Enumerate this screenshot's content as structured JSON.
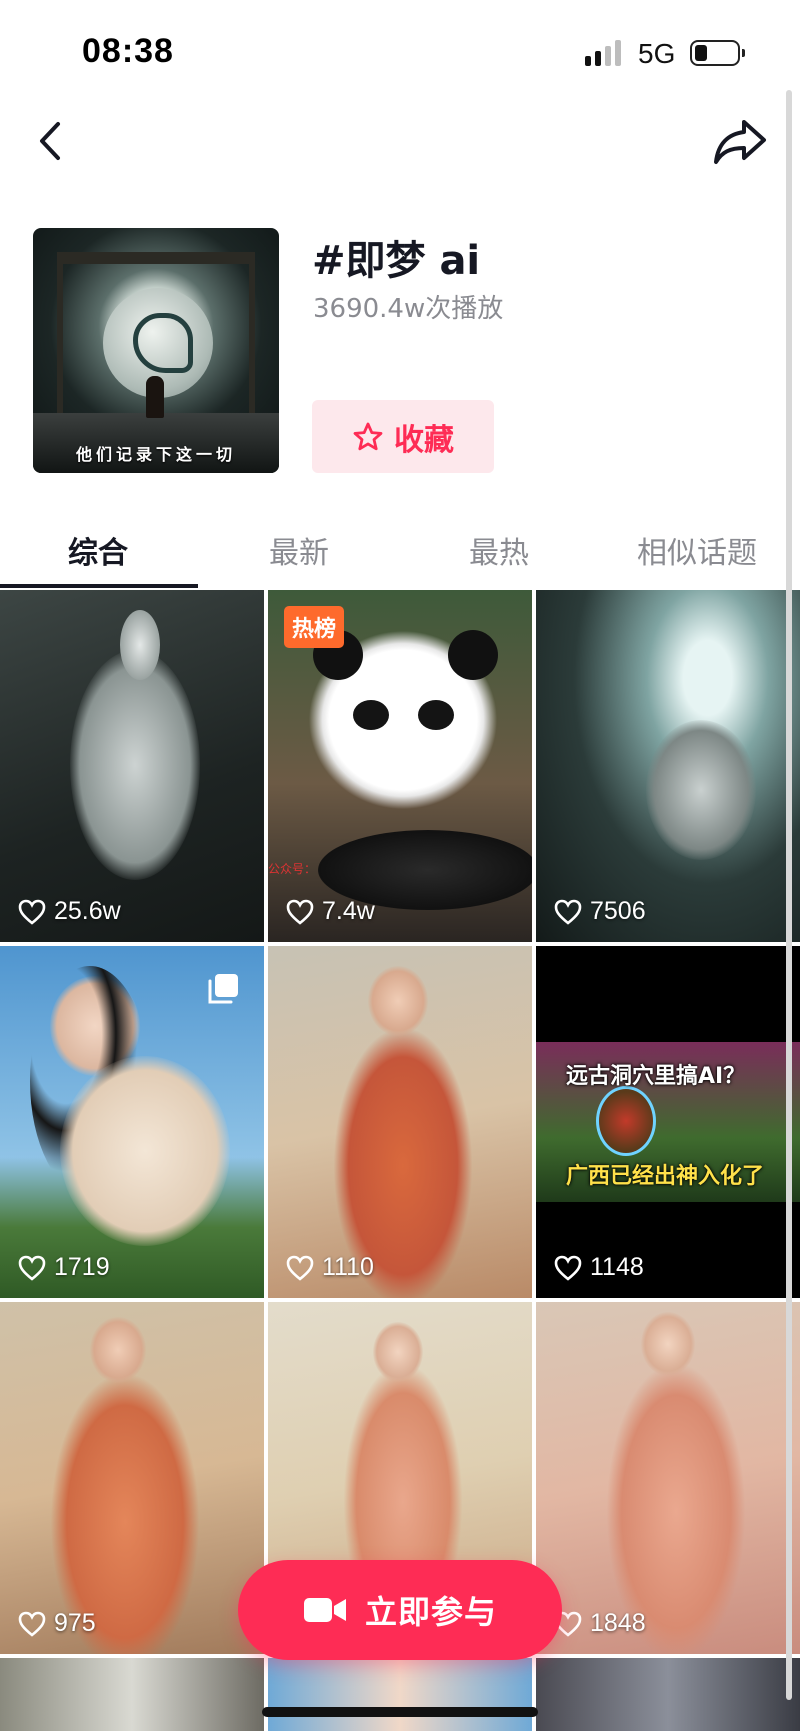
{
  "status_bar": {
    "time": "08:38",
    "network": "5G",
    "battery_level": 0.3
  },
  "header": {
    "title": "#即梦 ai",
    "play_count": "3690.4w次播放",
    "cover_caption": "他们记录下这一切",
    "favorite_label": "收藏"
  },
  "tabs": [
    {
      "label": "综合",
      "active": true
    },
    {
      "label": "最新",
      "active": false
    },
    {
      "label": "最热",
      "active": false
    },
    {
      "label": "相似话题",
      "active": false
    }
  ],
  "videos": [
    {
      "likes": "25.6w",
      "subject": "white fox spirit"
    },
    {
      "likes": "7.4w",
      "subject": "panda cooking",
      "badge": "热榜"
    },
    {
      "likes": "7506",
      "subject": "white horse in cave"
    },
    {
      "likes": "1719",
      "subject": "girl in sailor outfit",
      "multi_image": true
    },
    {
      "likes": "1110",
      "subject": "hanfu woman"
    },
    {
      "likes": "1148",
      "subject": "cave AI video thumbnail"
    },
    {
      "likes": "975",
      "subject": "hanfu woman"
    },
    {
      "likes": "",
      "subject": "hanfu woman with phoenix"
    },
    {
      "likes": "1848",
      "subject": "hanfu woman"
    }
  ],
  "thumb_text": {
    "panda_watermark": "公众号：",
    "cave_line1": "远古洞穴里搞AI？",
    "cave_line2": "广西已经出神入化了"
  },
  "cta_label": "立即参与",
  "colors": {
    "accent": "#fe2c55",
    "hot_badge": "#fe6a2c",
    "favorite_bg": "#fde8ec"
  }
}
